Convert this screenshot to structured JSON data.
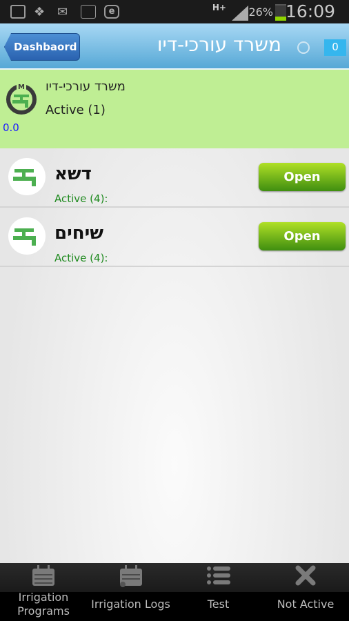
{
  "status_bar": {
    "time": "16:09",
    "battery_percent": "26%",
    "battery_level": 0.26,
    "network": "H+",
    "notification_icons": [
      "gallery-icon",
      "dropbox-icon",
      "email-icon",
      "monitor-icon",
      "e-icon"
    ]
  },
  "header": {
    "back_label": "Dashbaord",
    "title": "משרד עורכי-דיו",
    "mail_count": "0"
  },
  "hub": {
    "name": "משרד עורכי-דיו",
    "status": "Active (1)",
    "value": "0.0"
  },
  "valves": [
    {
      "name": "דשא",
      "status": "Active (4):",
      "button": "Open"
    },
    {
      "name": "שיחים",
      "status": "Active (4):",
      "button": "Open"
    }
  ],
  "tabs": [
    {
      "label": "Irrigation Programs",
      "line1": "Irrigation",
      "line2": "Programs",
      "icon": "calendar-icon"
    },
    {
      "label": "Irrigation Logs",
      "icon": "calendar-drop-icon"
    },
    {
      "label": "Test",
      "icon": "list-icon"
    },
    {
      "label": "Not Active",
      "icon": "close-icon"
    }
  ],
  "colors": {
    "header": "#56a8d6",
    "hub_bg": "#bfee94",
    "open_button": "#5fae18",
    "status_green": "#1f8a1f"
  }
}
